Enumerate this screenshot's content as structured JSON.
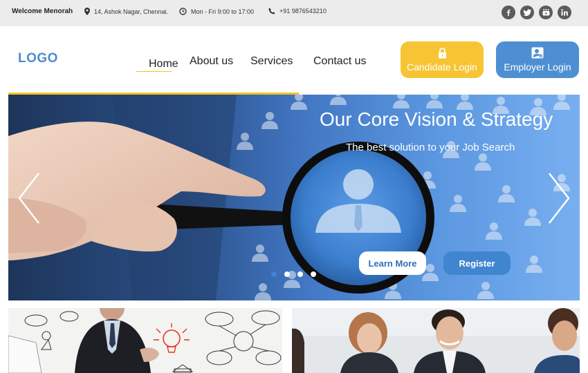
{
  "topbar": {
    "welcome": "Welcome Menorah",
    "address": "14, Ashok Nagar, Chennai.",
    "hours": "Mon - Fri 9:00 to 17:00",
    "phone": "+91 9876543210",
    "social": [
      "facebook-icon",
      "twitter-icon",
      "youtube-icon",
      "linkedin-icon"
    ]
  },
  "header": {
    "logo": "LOGO",
    "nav": [
      "Home",
      "About us",
      "Services",
      "Contact us"
    ],
    "active_nav": "Home",
    "candidate_login": "Candidate Login",
    "employer_login": "Employer Login"
  },
  "hero": {
    "title": "Our Core Vision & Strategy",
    "subtitle": "The best solution to your Job Search",
    "learn_more": "Learn More",
    "register": "Register",
    "slide_count": 4,
    "active_slide": 1
  },
  "colors": {
    "accent_yellow": "#f7c534",
    "accent_blue": "#4d8fd2",
    "logo_blue": "#4a8dd0",
    "topbar_bg": "#ececec"
  }
}
